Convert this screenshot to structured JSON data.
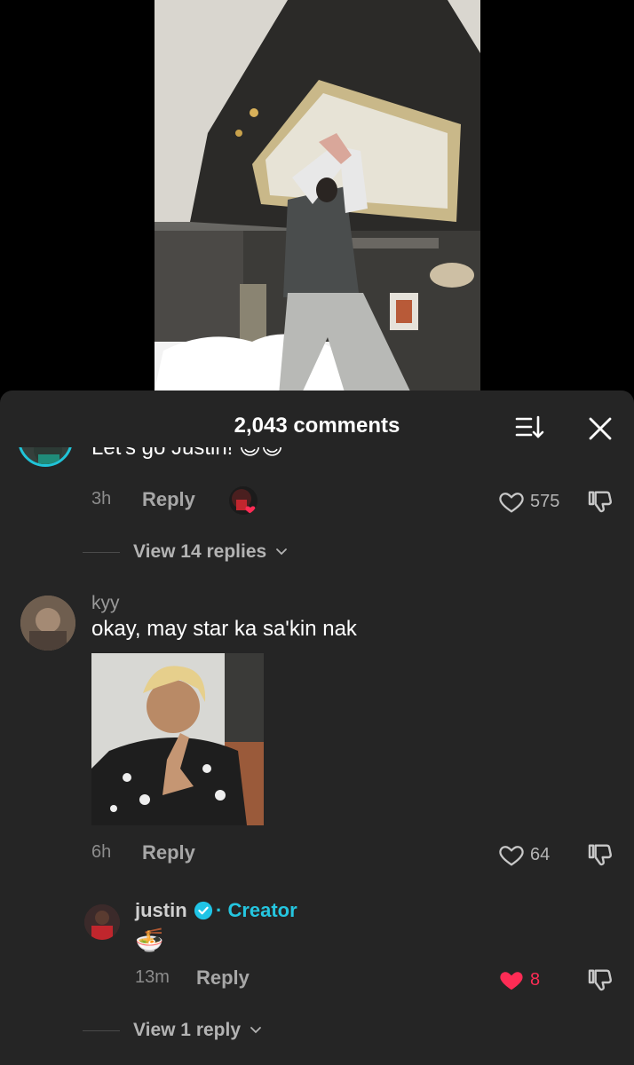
{
  "header": {
    "comments_count": "2,043 comments",
    "sort_icon": "sort-icon",
    "close_icon": "close-icon"
  },
  "comments": [
    {
      "text": "Let's go Justin! 😍😇",
      "time": "3h",
      "reply_label": "Reply",
      "likes": "575",
      "view_replies": "View 14 replies"
    },
    {
      "username": "kyy",
      "text": "okay, may star ka sa'kin nak",
      "time": "6h",
      "reply_label": "Reply",
      "likes": "64",
      "reply": {
        "username": "justin",
        "creator_tag": "· Creator",
        "text": "🍜",
        "time": "13m",
        "reply_label": "Reply",
        "likes": "8"
      },
      "view_replies": "View 1 reply"
    }
  ],
  "colors": {
    "sheet_bg": "#252525",
    "creator_accent": "#25c6e0",
    "liked_heart": "#fe2c55"
  }
}
